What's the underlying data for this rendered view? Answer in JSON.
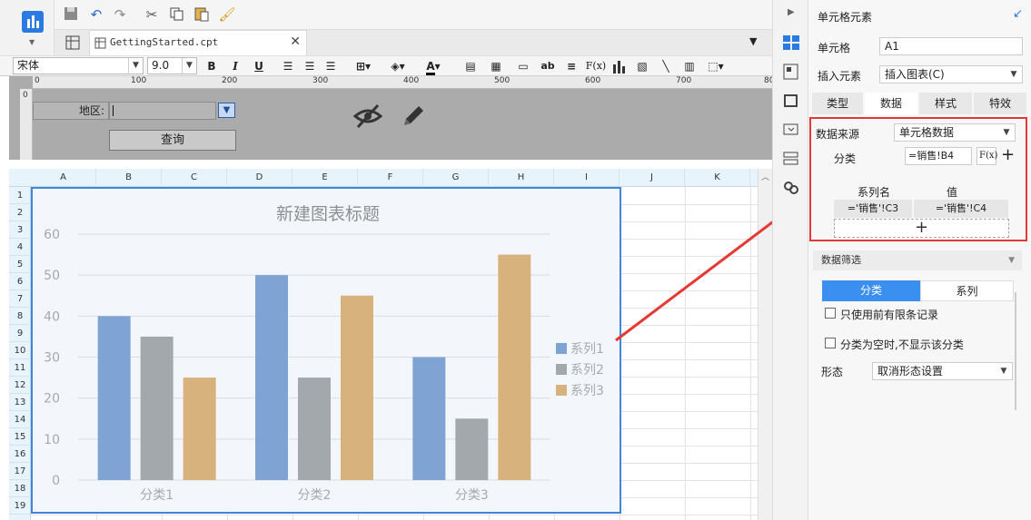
{
  "toolbar": {
    "file_tab": "GettingStarted.cpt",
    "font_name": "宋体",
    "font_size": "9.0",
    "bold": "B",
    "italic": "I",
    "underline": "U",
    "text_label": "ab",
    "formula": "F(x)"
  },
  "form": {
    "region_label": "地区:",
    "query_button": "查询"
  },
  "ruler": [
    "0",
    "100",
    "200",
    "300",
    "400",
    "500",
    "600",
    "700",
    "80"
  ],
  "ruler_v": "0",
  "grid": {
    "columns": [
      "A",
      "B",
      "C",
      "D",
      "E",
      "F",
      "G",
      "H",
      "I",
      "J",
      "K"
    ],
    "rows": [
      "1",
      "2",
      "3",
      "4",
      "5",
      "6",
      "7",
      "8",
      "9",
      "10",
      "11",
      "12",
      "13",
      "14",
      "15",
      "16",
      "17",
      "18",
      "19"
    ]
  },
  "chart_data": {
    "type": "bar",
    "title": "新建图表标题",
    "categories": [
      "分类1",
      "分类2",
      "分类3"
    ],
    "series": [
      {
        "name": "系列1",
        "values": [
          40,
          50,
          30
        ],
        "color": "#7fa3d2"
      },
      {
        "name": "系列2",
        "values": [
          35,
          25,
          15
        ],
        "color": "#a3a8ad"
      },
      {
        "name": "系列3",
        "values": [
          25,
          45,
          55
        ],
        "color": "#d8b27d"
      }
    ],
    "yticks": [
      "0",
      "10",
      "20",
      "30",
      "40",
      "50",
      "60"
    ],
    "ylim": [
      0,
      60
    ],
    "grid": true,
    "legend_position": "right"
  },
  "panel": {
    "title": "单元格元素",
    "cell_label": "单元格",
    "cell_value": "A1",
    "insert_label": "插入元素",
    "insert_value": "插入图表(C)",
    "tabs": [
      "类型",
      "数据",
      "样式",
      "特效"
    ],
    "active_tab": "数据",
    "data_source_label": "数据来源",
    "data_source_value": "单元格数据",
    "category_label": "分类",
    "category_value": "=销售!B4",
    "fx": "F(x)",
    "series_name_header": "系列名",
    "value_header": "值",
    "series_name_cell": "='销售'!C3",
    "value_cell": "='销售'!C4",
    "add_symbol": "+",
    "filter_header": "数据筛选",
    "filter_tabs": [
      "分类",
      "系列"
    ],
    "option1": "只使用前有限条记录",
    "option2": "分类为空时,不显示该分类",
    "form_label": "形态",
    "form_value": "取消形态设置"
  },
  "colors": {
    "accent": "#3d86d8",
    "highlight": "#e53935",
    "tab_active": "#3b8ff0"
  }
}
